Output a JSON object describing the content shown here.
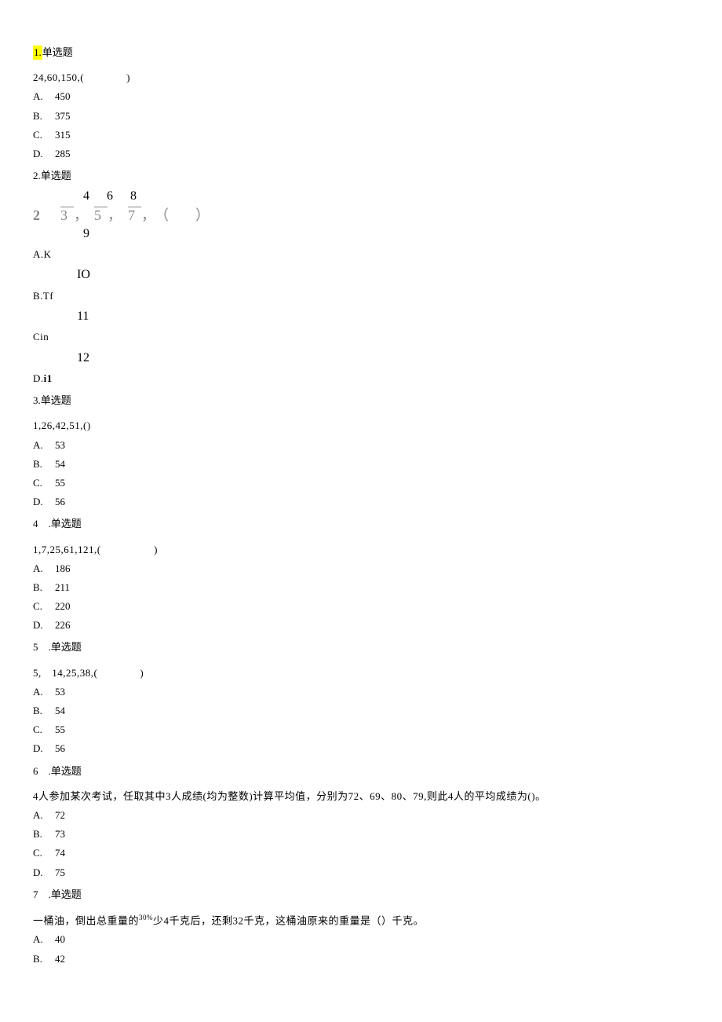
{
  "q1": {
    "num_highlight": "1.",
    "type_label": "单选题",
    "stem": "24,60,150,(    )",
    "opts": {
      "A": "450",
      "B": "375",
      "C": "315",
      "D": "285"
    }
  },
  "q2": {
    "header": "2.单选题",
    "frac_top": "468",
    "frac_mid_two": "2",
    "frac_mid_rest": "，3，5，7，（ ）",
    "frac_bot": "9",
    "A_label": "A.K",
    "A_num": "IO",
    "B_label": "B.Tf",
    "B_num": "11",
    "C_label": "Cin",
    "C_num": "12",
    "D_label": "D.",
    "D_val": "i1"
  },
  "q3": {
    "header": "3.单选题",
    "stem": "1,26,42,51,()",
    "opts": {
      "A": "53",
      "B": "54",
      "C": "55",
      "D": "56"
    }
  },
  "q4": {
    "header": "4 .单选题",
    "stem": "1,7,25,61,121,(     )",
    "opts": {
      "A": "186",
      "B": "211",
      "C": "220",
      "D": "226"
    }
  },
  "q5": {
    "header": "5 .单选题",
    "stem": "5, 14,25,38,(    )",
    "opts": {
      "A": "53",
      "B": "54",
      "C": "55",
      "D": "56"
    }
  },
  "q6": {
    "header": "6 .单选题",
    "stem": "4人参加某次考试，任取其中3人成绩(均为整数)计算平均值，分别为72、69、80、79,则此4人的平均成绩为()。",
    "opts": {
      "A": "72",
      "B": "73",
      "C": "74",
      "D": "75"
    }
  },
  "q7": {
    "header": "7 .单选题",
    "stem_pre": "一桶油，倒出总重量的",
    "stem_pct": "30%",
    "stem_post": "少4千克后，还剩32千克，这桶油原来的重量是（）千克。",
    "opts": {
      "A": "40",
      "B": "42"
    }
  }
}
